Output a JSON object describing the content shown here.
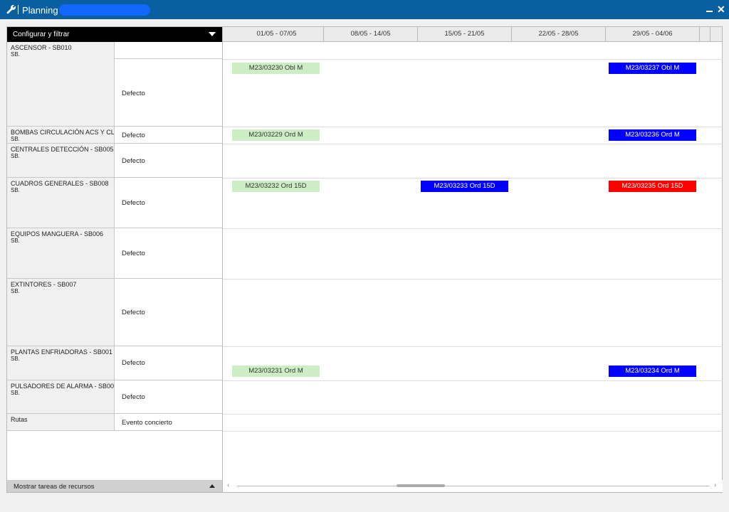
{
  "window": {
    "title": "Planning"
  },
  "config_filter": {
    "label": "Configurar y filtrar"
  },
  "weeks": [
    "01/05 - 07/05",
    "08/05 - 14/05",
    "15/05 - 21/05",
    "22/05 - 28/05",
    "29/05 - 04/06"
  ],
  "resources": [
    {
      "name": "ASCENSOR - SB010",
      "sub": "SB.",
      "schedule": "Defecto"
    },
    {
      "name": "BOMBAS CIRCULACIÓN ACS Y CL",
      "sub": "SB.",
      "schedule": "Defecto"
    },
    {
      "name": "CENTRALES DETECCIÓN - SB005",
      "sub": "SB.",
      "schedule": "Defecto"
    },
    {
      "name": "CUADROS GENERALES - SB008",
      "sub": "SB.",
      "schedule": "Defecto"
    },
    {
      "name": "EQUIPOS MANGUERA - SB006",
      "sub": "SB.",
      "schedule": "Defecto"
    },
    {
      "name": "EXTINTORES - SB007",
      "sub": "SB.",
      "schedule": "Defecto"
    },
    {
      "name": "PLANTAS ENFRIADORAS - SB001",
      "sub": "SB.",
      "schedule": "Defecto"
    },
    {
      "name": "PULSADORES DE ALARMA - SB00",
      "sub": "SB.",
      "schedule": "Defecto"
    },
    {
      "name": "Rutas",
      "sub": "",
      "schedule": "Evento concierto"
    }
  ],
  "tasks": [
    {
      "label": "M23/03230  Obl  M",
      "color": "green",
      "resource": "ASCENSOR - SB010",
      "week": "01/05 - 07/05"
    },
    {
      "label": "M23/03237  Obl  M",
      "color": "blue",
      "resource": "ASCENSOR - SB010",
      "week": "29/05 - 04/06"
    },
    {
      "label": "M23/03229  Ord  M",
      "color": "green",
      "resource": "BOMBAS CIRCULACIÓN ACS Y CL",
      "week": "01/05 - 07/05"
    },
    {
      "label": "M23/03236  Ord  M",
      "color": "blue",
      "resource": "BOMBAS CIRCULACIÓN ACS Y CL",
      "week": "29/05 - 04/06"
    },
    {
      "label": "M23/03232  Ord  15D",
      "color": "green",
      "resource": "CUADROS GENERALES - SB008",
      "week": "01/05 - 07/05"
    },
    {
      "label": "M23/03233  Ord  15D",
      "color": "blue",
      "resource": "CUADROS GENERALES - SB008",
      "week": "15/05 - 21/05"
    },
    {
      "label": "M23/03235  Ord  15D",
      "color": "red",
      "resource": "CUADROS GENERALES - SB008",
      "week": "29/05 - 04/06"
    },
    {
      "label": "M23/03231  Ord  M",
      "color": "green",
      "resource": "PLANTAS ENFRIADORAS - SB001",
      "week": "01/05 - 07/05"
    },
    {
      "label": "M23/03234  Ord  M",
      "color": "blue",
      "resource": "PLANTAS ENFRIADORAS - SB001",
      "week": "29/05 - 04/06"
    }
  ],
  "footer": {
    "label": "Mostrar tareas de recursos"
  },
  "colors": {
    "titlebar": "#0a5fa0",
    "task_green": "#cdeec5",
    "task_blue": "#0000ff",
    "task_red": "#ff0000"
  }
}
